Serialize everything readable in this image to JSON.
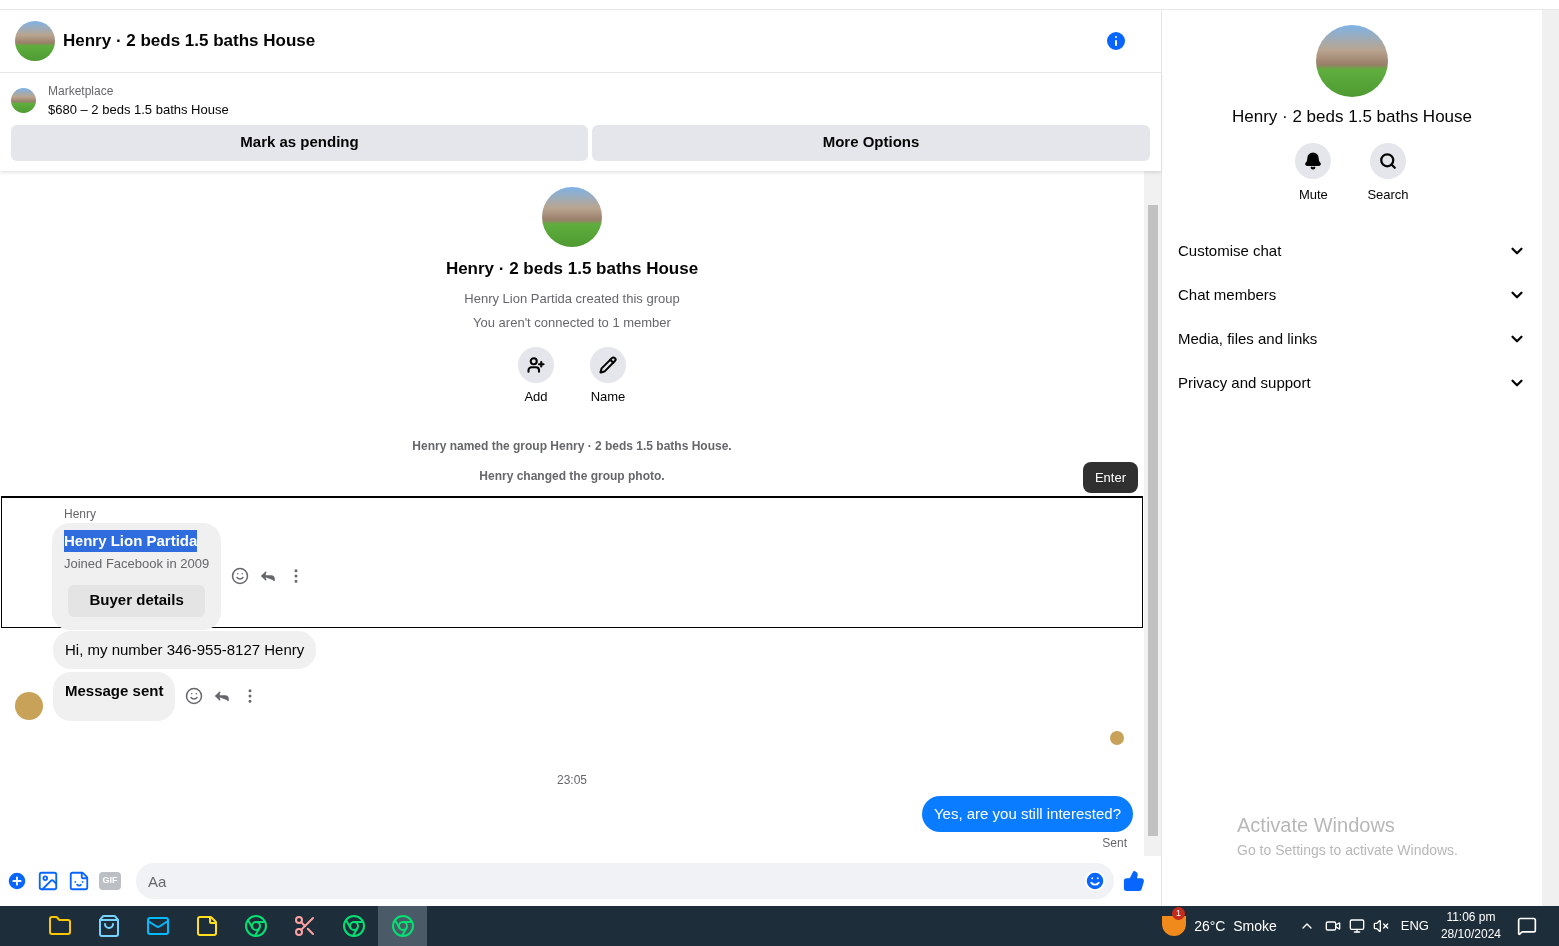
{
  "header": {
    "title": "Henry · 2 beds 1.5 baths House"
  },
  "listing": {
    "source": "Marketplace",
    "summary": "$680 – 2 beds 1.5 baths House",
    "actions": [
      "Mark as pending",
      "More Options"
    ]
  },
  "intro": {
    "title": "Henry · 2 beds 1.5 baths House",
    "lines": [
      "Henry Lion Partida created this group",
      "You aren't connected to 1 member"
    ],
    "actions": [
      {
        "kind": "add",
        "label": "Add"
      },
      {
        "kind": "name",
        "label": "Name"
      }
    ]
  },
  "events": [
    "Henry named the group Henry · 2 beds 1.5 baths House.",
    "Henry changed the group photo."
  ],
  "tooltip": "Enter",
  "card": {
    "sender": "Henry",
    "name": "Henry Lion Partida",
    "name_selected": true,
    "joined": "Joined Facebook in 2009",
    "button": "Buyer details"
  },
  "messages": [
    {
      "text": "Hi, my number 346-955-8127 Henry",
      "bold": false,
      "actions": false,
      "avatar": false
    },
    {
      "text": "Message sent",
      "bold": true,
      "actions": true,
      "avatar": true
    }
  ],
  "time": "23:05",
  "outgoing": {
    "text": "Yes, are you still interested?",
    "status": "Sent"
  },
  "composer": {
    "placeholder": "Aa",
    "gif_label": "GIF"
  },
  "panel": {
    "title": "Henry · 2 beds 1.5 baths House",
    "actions": [
      {
        "kind": "mute",
        "label": "Mute"
      },
      {
        "kind": "search",
        "label": "Search"
      }
    ],
    "sections": [
      {
        "label": "Customise chat",
        "expanded": false
      },
      {
        "label": "Chat members",
        "expanded": false
      },
      {
        "label": "Media, files and links",
        "expanded": false
      },
      {
        "label": "Privacy and support",
        "expanded": false
      }
    ]
  },
  "activation": {
    "title": "Activate Windows",
    "subtitle": "Go to Settings to activate Windows."
  },
  "taskbar": {
    "apps": [
      {
        "kind": "folder",
        "selected": false
      },
      {
        "kind": "store",
        "selected": false
      },
      {
        "kind": "mail",
        "selected": false
      },
      {
        "kind": "notes",
        "selected": false
      },
      {
        "kind": "chrome",
        "selected": false
      },
      {
        "kind": "snip",
        "selected": false
      },
      {
        "kind": "chrome",
        "selected": false
      },
      {
        "kind": "chrome",
        "selected": true
      }
    ],
    "weather_badge": "1",
    "weather": "26°C  Smoke",
    "language": "ENG",
    "clock_time": "11:06 pm",
    "clock_date": "28/10/2024"
  }
}
